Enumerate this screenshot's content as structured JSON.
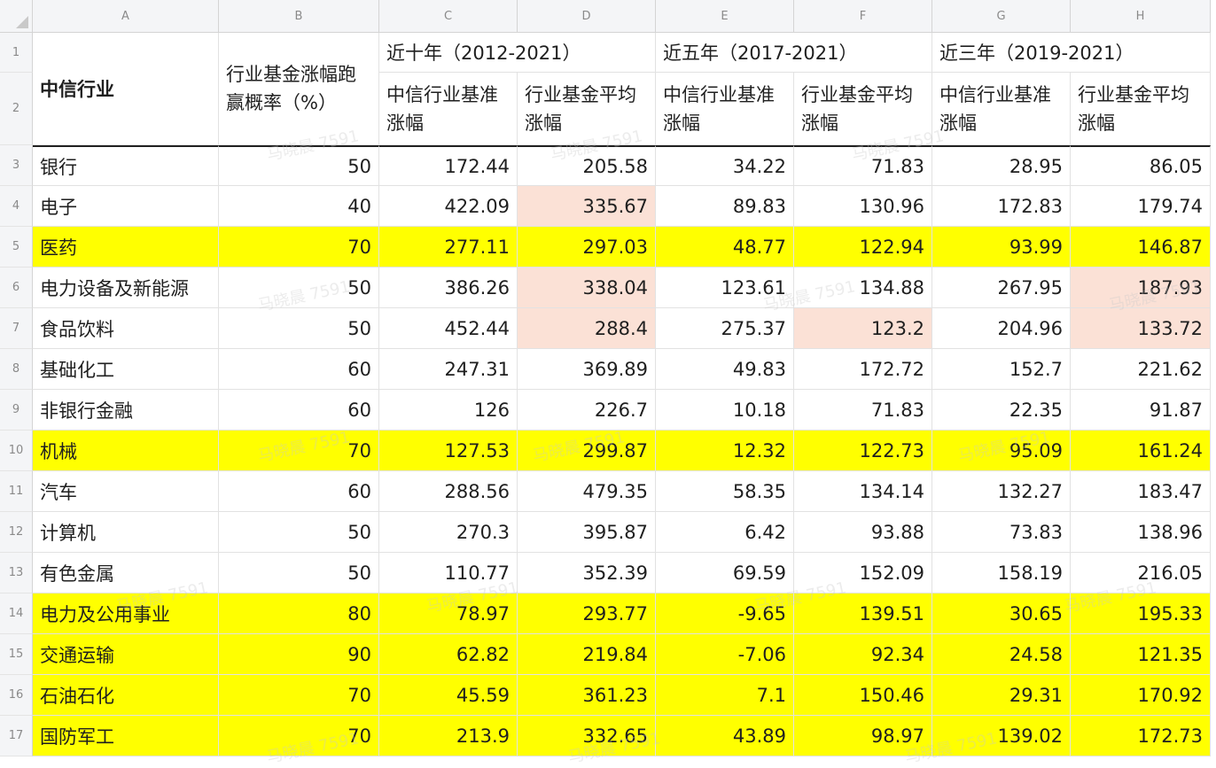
{
  "column_letters": [
    "A",
    "B",
    "C",
    "D",
    "E",
    "F",
    "G",
    "H"
  ],
  "row_numbers": [
    "1",
    "2",
    "3",
    "4",
    "5",
    "6",
    "7",
    "8",
    "9",
    "10",
    "11",
    "12",
    "13",
    "14",
    "15",
    "16",
    "17"
  ],
  "header": {
    "industry": "中信行业",
    "win_rate": "行业基金涨幅跑赢概率（%）",
    "period_10y": "近十年（2012-2021）",
    "period_5y": "近五年（2017-2021）",
    "period_3y": "近三年（2019-2021）",
    "sub_benchmark": "中信行业基准涨幅",
    "sub_fund_avg": "行业基金平均涨幅"
  },
  "rows": [
    {
      "name": "银行",
      "win": "50",
      "c": "172.44",
      "d": "205.58",
      "e": "34.22",
      "f": "71.83",
      "g": "28.95",
      "h": "86.05"
    },
    {
      "name": "电子",
      "win": "40",
      "c": "422.09",
      "d": "335.67",
      "e": "89.83",
      "f": "130.96",
      "g": "172.83",
      "h": "179.74"
    },
    {
      "name": "医药",
      "win": "70",
      "c": "277.11",
      "d": "297.03",
      "e": "48.77",
      "f": "122.94",
      "g": "93.99",
      "h": "146.87"
    },
    {
      "name": "电力设备及新能源",
      "win": "50",
      "c": "386.26",
      "d": "338.04",
      "e": "123.61",
      "f": "134.88",
      "g": "267.95",
      "h": "187.93"
    },
    {
      "name": "食品饮料",
      "win": "50",
      "c": "452.44",
      "d": "288.4",
      "e": "275.37",
      "f": "123.2",
      "g": "204.96",
      "h": "133.72"
    },
    {
      "name": "基础化工",
      "win": "60",
      "c": "247.31",
      "d": "369.89",
      "e": "49.83",
      "f": "172.72",
      "g": "152.7",
      "h": "221.62"
    },
    {
      "name": "非银行金融",
      "win": "60",
      "c": "126",
      "d": "226.7",
      "e": "10.18",
      "f": "71.83",
      "g": "22.35",
      "h": "91.87"
    },
    {
      "name": "机械",
      "win": "70",
      "c": "127.53",
      "d": "299.87",
      "e": "12.32",
      "f": "122.73",
      "g": "95.09",
      "h": "161.24"
    },
    {
      "name": "汽车",
      "win": "60",
      "c": "288.56",
      "d": "479.35",
      "e": "58.35",
      "f": "134.14",
      "g": "132.27",
      "h": "183.47"
    },
    {
      "name": "计算机",
      "win": "50",
      "c": "270.3",
      "d": "395.87",
      "e": "6.42",
      "f": "93.88",
      "g": "73.83",
      "h": "138.96"
    },
    {
      "name": "有色金属",
      "win": "50",
      "c": "110.77",
      "d": "352.39",
      "e": "69.59",
      "f": "152.09",
      "g": "158.19",
      "h": "216.05"
    },
    {
      "name": "电力及公用事业",
      "win": "80",
      "c": "78.97",
      "d": "293.77",
      "e": "-9.65",
      "f": "139.51",
      "g": "30.65",
      "h": "195.33"
    },
    {
      "name": "交通运输",
      "win": "90",
      "c": "62.82",
      "d": "219.84",
      "e": "-7.06",
      "f": "92.34",
      "g": "24.58",
      "h": "121.35"
    },
    {
      "name": "石油石化",
      "win": "70",
      "c": "45.59",
      "d": "361.23",
      "e": "7.1",
      "f": "150.46",
      "g": "29.31",
      "h": "170.92"
    },
    {
      "name": "国防军工",
      "win": "70",
      "c": "213.9",
      "d": "332.65",
      "e": "43.89",
      "f": "98.97",
      "g": "139.02",
      "h": "172.73"
    }
  ],
  "highlight_rows": [
    2,
    7,
    11,
    12,
    13,
    14
  ],
  "pink_cells": [
    [
      1,
      "d"
    ],
    [
      3,
      "d"
    ],
    [
      3,
      "h"
    ],
    [
      4,
      "d"
    ],
    [
      4,
      "f"
    ],
    [
      4,
      "h"
    ]
  ],
  "colors": {
    "highlight": "#ffff00",
    "pink": "#fbe1d6",
    "header_bg": "#f4f5f7"
  },
  "watermark": "马晓晨 7591"
}
